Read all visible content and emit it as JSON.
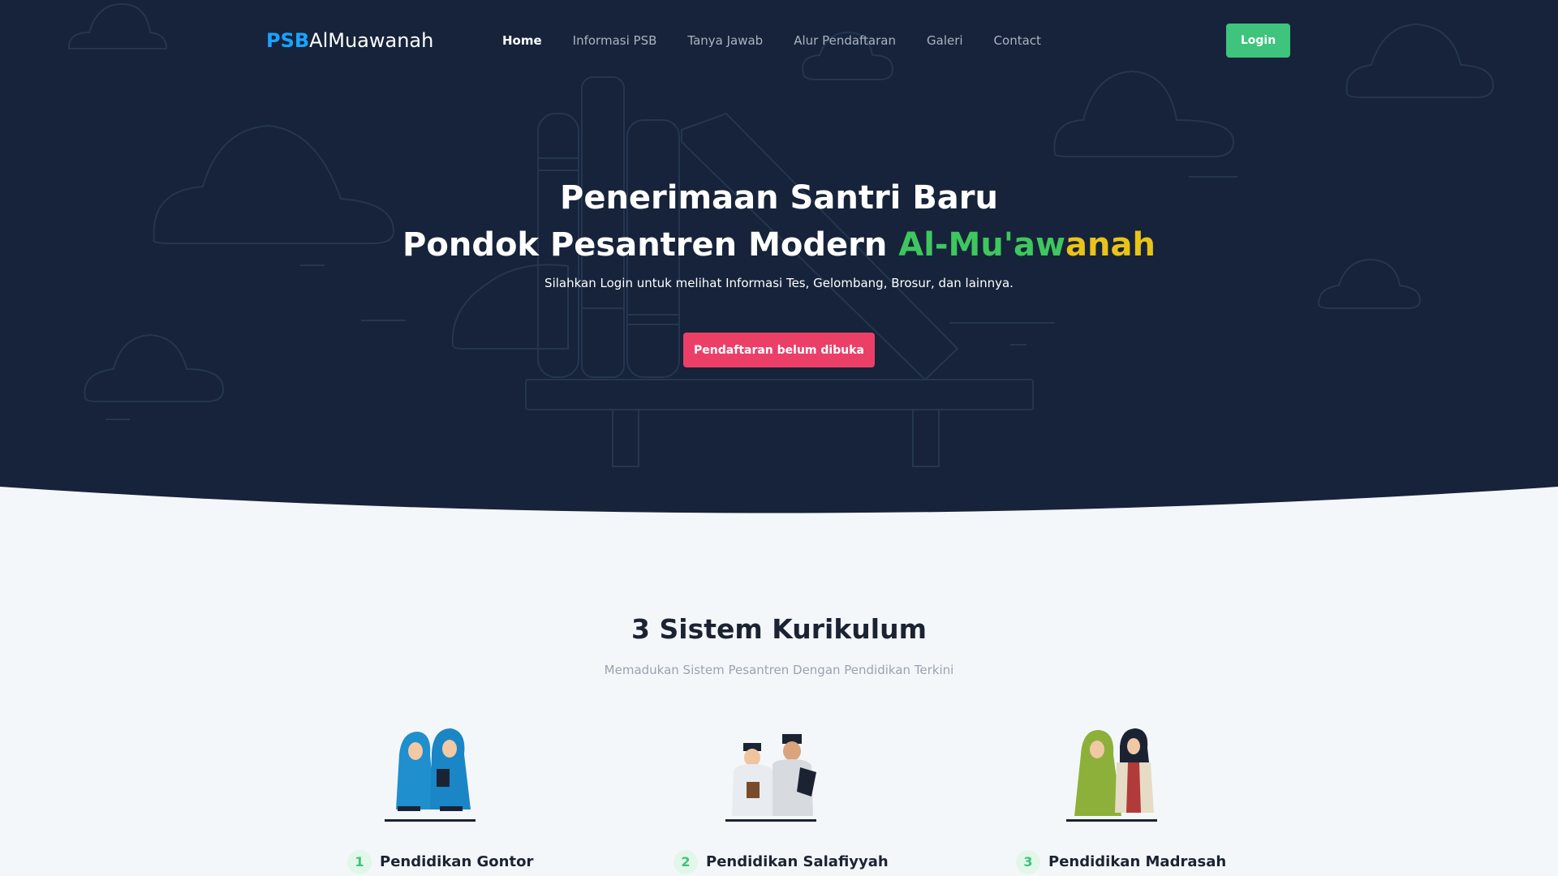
{
  "brand": {
    "prefix": "PSB",
    "name": "AlMuawanah"
  },
  "nav": {
    "items": [
      "Home",
      "Informasi PSB",
      "Tanya Jawab",
      "Alur Pendaftaran",
      "Galeri",
      "Contact"
    ],
    "active": "Home",
    "login_label": "Login"
  },
  "hero": {
    "title_line1": "Penerimaan Santri Baru",
    "title_line2_prefix": "Pondok Pesantren Modern ",
    "title_highlight_green": "Al-Mu'aw",
    "title_highlight_yellow": "anah",
    "subtitle": "Silahkan Login untuk melihat Informasi Tes, Gelombang, Brosur, dan lainnya.",
    "button_label": "Pendaftaran belum dibuka"
  },
  "curriculum": {
    "title": "3 Sistem Kurikulum",
    "subtitle": "Memadukan Sistem Pesantren Dengan Pendidikan Terkini",
    "items": [
      {
        "number": "1",
        "label": "Pendidikan Gontor"
      },
      {
        "number": "2",
        "label": "Pendidikan Salafiyyah"
      },
      {
        "number": "3",
        "label": "Pendidikan Madrasah"
      }
    ]
  },
  "colors": {
    "hero_bg": "#16233a",
    "accent_green": "#3ec47c",
    "accent_yellow": "#e9c318",
    "brand_blue": "#1aa3ff",
    "button_pink": "#ec3f68",
    "section_bg": "#f4f7fa"
  }
}
